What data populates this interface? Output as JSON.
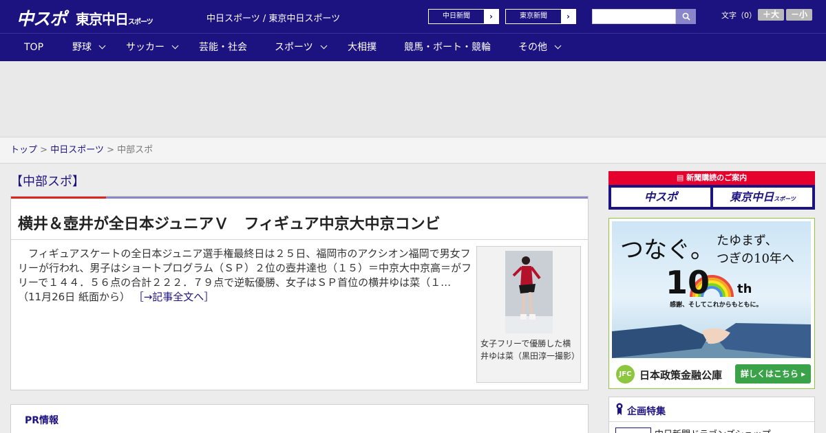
{
  "header": {
    "logo_main": "中スポ",
    "logo_tokyo": "東京中日",
    "logo_tokyo_small": "スポーツ",
    "site_title": "中日スポーツ / 東京中日スポーツ",
    "links": [
      {
        "label": "中日新聞"
      },
      {
        "label": "東京新聞"
      }
    ],
    "search_placeholder": "",
    "text_size_label": "文字（0）",
    "size_up_label": "＋大",
    "size_down_label": "－小"
  },
  "nav": {
    "items": [
      {
        "label": "TOP",
        "has_dropdown": false
      },
      {
        "label": "野球",
        "has_dropdown": true
      },
      {
        "label": "サッカー",
        "has_dropdown": true
      },
      {
        "label": "芸能・社会",
        "has_dropdown": false
      },
      {
        "label": "スポーツ",
        "has_dropdown": true
      },
      {
        "label": "大相撲",
        "has_dropdown": false
      },
      {
        "label": "競馬・ボート・競輪",
        "has_dropdown": false
      },
      {
        "label": "その他",
        "has_dropdown": true
      }
    ]
  },
  "breadcrumb": {
    "items": [
      "トップ",
      "中日スポーツ",
      "中部スポ"
    ],
    "separator": ">"
  },
  "main": {
    "section_heading": "【中部スポ】",
    "article": {
      "title": "横井＆壺井が全日本ジュニアＶ　フィギュア中京大中京コンビ",
      "body": "フィギュアスケートの全日本ジュニア選手権最終日は２５日、福岡市のアクシオン福岡で男女フリーが行われ、男子はショートプログラム（ＳＰ）２位の壺井達也（１５）＝中京大中京高＝がフリーで１４４．５６点の合計２２２．７９点で逆転優勝、女子はＳＰ首位の横井ゆは菜（１…（11月26日 紙面から）",
      "read_more": "［→記事全文へ］",
      "photo_caption": "女子フリーで優勝した横井ゆは菜（黒田淳一撮影）"
    },
    "pr_title": "PR情報"
  },
  "sidebar": {
    "subscribe": {
      "heading": "新聞購読のご案内",
      "btn_chuspo": "中スポ",
      "btn_tokyo": "東京中日",
      "btn_tokyo_small": "スポーツ"
    },
    "banner": {
      "main": "つなぐ。",
      "sub_line1": "たゆまず、",
      "sub_line2": "つぎの10年へ",
      "ten": "10",
      "th": "th",
      "thanks": "感謝、そしてこれからもともに。",
      "jfc_logo": "JFC",
      "jfc_name": "日本政策金融公庫",
      "cta": "詳しくはこちら ▸"
    },
    "feature": {
      "title": "企画特集",
      "item": "中日新聞ドラゴンズショップ"
    }
  },
  "colors": {
    "brand_navy": "#1d1380",
    "accent_red": "#d9251c",
    "accent_purple": "#8a86c9",
    "jfc_green": "#3aa34a"
  }
}
